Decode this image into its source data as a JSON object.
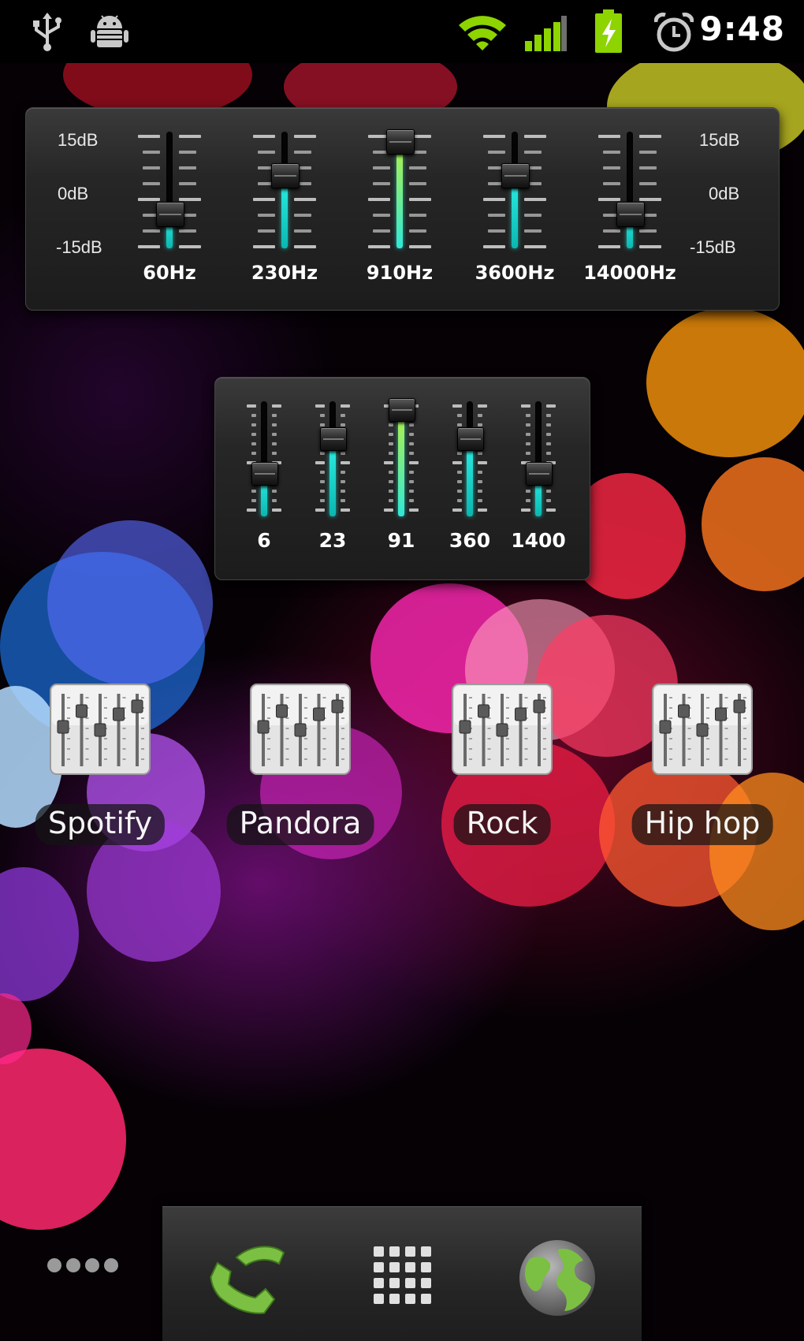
{
  "status_bar": {
    "left_icons": [
      "usb-icon",
      "android-debug-icon"
    ],
    "right_icons": [
      "wifi-icon",
      "signal-icon",
      "battery-charging-icon",
      "alarm-icon"
    ],
    "time": "9:48",
    "accent_color": "#8dd400"
  },
  "eq_large": {
    "db_labels_left": [
      "15dB",
      "0dB",
      "-15dB"
    ],
    "db_labels_right": [
      "15dB",
      "0dB",
      "-15dB"
    ],
    "bands": [
      {
        "label": "60Hz",
        "level_fraction": 0.3
      },
      {
        "label": "230Hz",
        "level_fraction": 0.63
      },
      {
        "label": "910Hz",
        "level_fraction": 0.92
      },
      {
        "label": "3600Hz",
        "level_fraction": 0.63
      },
      {
        "label": "14000Hz",
        "level_fraction": 0.3
      }
    ]
  },
  "eq_small": {
    "bands": [
      {
        "label": "6",
        "level_fraction": 0.38
      },
      {
        "label": "23",
        "level_fraction": 0.68
      },
      {
        "label": "91",
        "level_fraction": 0.93
      },
      {
        "label": "360",
        "level_fraction": 0.68
      },
      {
        "label": "1400",
        "level_fraction": 0.38
      }
    ]
  },
  "shortcuts": [
    {
      "label": "Spotify",
      "icon": "equalizer-app-icon"
    },
    {
      "label": "Pandora",
      "icon": "equalizer-app-icon"
    },
    {
      "label": "Rock",
      "icon": "equalizer-app-icon"
    },
    {
      "label": "Hip hop",
      "icon": "equalizer-app-icon"
    }
  ],
  "dock": {
    "items": [
      "phone-icon",
      "app-drawer-icon",
      "browser-globe-icon"
    ],
    "left_indicator": "more-pages-dots-icon",
    "phone_color": "#7bc043"
  },
  "colors": {
    "eq_fill": "#1fd6cf",
    "eq_fill_peak": "#a8ec3a"
  }
}
